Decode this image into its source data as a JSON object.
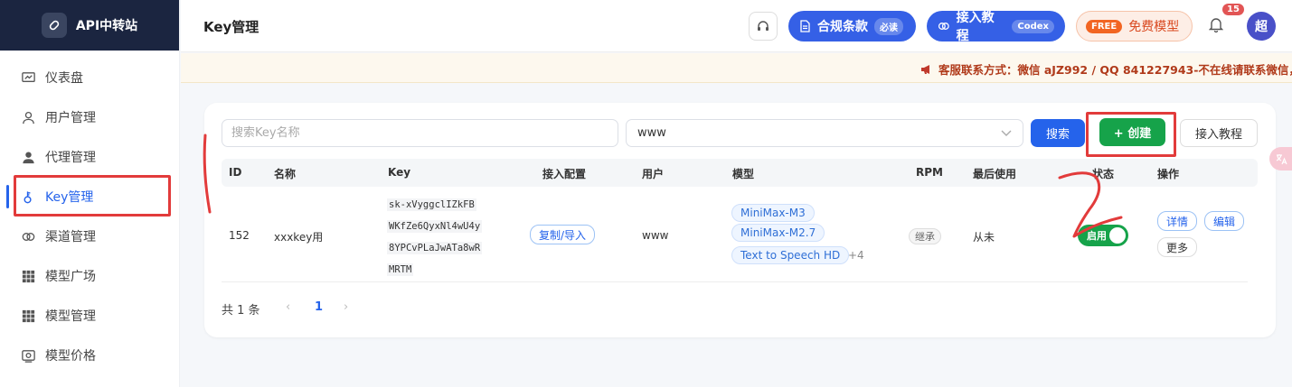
{
  "brand": {
    "name": "API中转站"
  },
  "nav": [
    {
      "label": "仪表盘",
      "icon": "dashboard-icon"
    },
    {
      "label": "用户管理",
      "icon": "user-icon"
    },
    {
      "label": "代理管理",
      "icon": "agent-icon"
    },
    {
      "label": "Key管理",
      "icon": "key-icon",
      "active": true
    },
    {
      "label": "渠道管理",
      "icon": "link-icon"
    },
    {
      "label": "模型广场",
      "icon": "grid-icon"
    },
    {
      "label": "模型管理",
      "icon": "grid-icon"
    },
    {
      "label": "模型价格",
      "icon": "price-icon"
    }
  ],
  "header": {
    "title": "Key管理",
    "compliance_label": "合规条款",
    "compliance_tag": "必读",
    "tutorial_label": "接入教程",
    "tutorial_tag": "Codex",
    "free_tag": "FREE",
    "free_label": "免费模型",
    "notification_count": "15",
    "avatar_text": "超"
  },
  "notice": {
    "text": "客服联系方式：微信 aJZ992 / QQ 841227943-不在线请联系微信，"
  },
  "toolbar": {
    "search_placeholder": "搜索Key名称",
    "select_value": "www",
    "search_label": "搜索",
    "create_label": "+ 创建",
    "guide_label": "接入教程"
  },
  "table": {
    "headers": [
      "ID",
      "名称",
      "Key",
      "接入配置",
      "用户",
      "模型",
      "RPM",
      "最后使用",
      "状态",
      "操作"
    ],
    "rows": [
      {
        "id": "152",
        "name": "xxxkey用",
        "key_lines": [
          "sk-xVyggclIZkFB",
          "WKfZe6QyxNl4wU4y",
          "8YPCvPLaJwATa8wR",
          "MRTM"
        ],
        "config_label": "复制/导入",
        "user": "www",
        "models": [
          "MiniMax-M3",
          "MiniMax-M2.7",
          "Text to Speech HD"
        ],
        "models_more": "+4",
        "rpm": "继承",
        "last_used": "从未",
        "status": "启用",
        "actions": [
          "详情",
          "编辑",
          "更多"
        ]
      }
    ]
  },
  "pagination": {
    "total": "共 1 条",
    "prev": "‹",
    "current": "1",
    "next": "›"
  },
  "annotation": {
    "stroke_color": "#e23b3b",
    "number": "2"
  },
  "colors": {
    "primary": "#2563eb",
    "success": "#16a34a",
    "brand_bg": "#1b2540"
  }
}
